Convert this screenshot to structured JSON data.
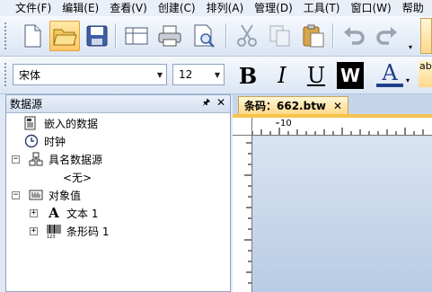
{
  "menu": [
    "文件(F)",
    "编辑(E)",
    "查看(V)",
    "创建(C)",
    "排列(A)",
    "管理(D)",
    "工具(T)",
    "窗口(W)",
    "帮助"
  ],
  "toolbar": {
    "icons": [
      "new-document",
      "open-folder",
      "save",
      "page-setup",
      "print",
      "print-preview",
      "cut",
      "copy",
      "paste",
      "undo",
      "redo"
    ]
  },
  "format_bar": {
    "font": "宋体",
    "size": "12",
    "bold": "B",
    "italic": "I",
    "underline": "U",
    "wordwrap": "W",
    "font_color": "A",
    "partial": "ab"
  },
  "panel": {
    "title": "数据源",
    "pin": "📌",
    "close": "✕",
    "items": [
      {
        "label": "嵌入的数据",
        "icon": "embedded-data"
      },
      {
        "label": "时钟",
        "icon": "clock"
      },
      {
        "label": "具名数据源",
        "icon": "named-datasource",
        "expander": "⊟"
      },
      {
        "label": "<无>",
        "icon": ""
      },
      {
        "label": "对象值",
        "icon": "object-values",
        "expander": "⊟"
      },
      {
        "label": "文本 1",
        "icon": "text-object",
        "expander": "⊞"
      },
      {
        "label": "条形码 1",
        "icon": "barcode-object",
        "expander": "⊞"
      }
    ]
  },
  "document": {
    "tab_label": "条码：662.btw",
    "tab_close": "✕",
    "ruler_label": "10"
  },
  "colors": {
    "accent": "#f5c34e",
    "panel_border": "#8ea3c3"
  }
}
